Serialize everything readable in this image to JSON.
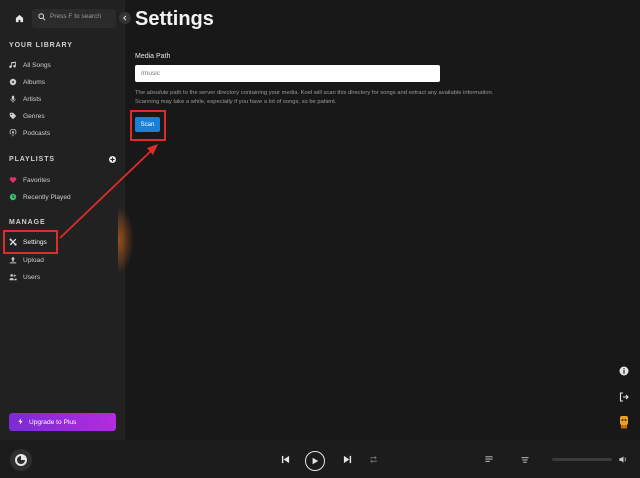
{
  "sidebar": {
    "search": {
      "placeholder": "Press F to search"
    },
    "library": {
      "title": "YOUR LIBRARY",
      "items": [
        {
          "label": "All Songs",
          "icon": "music-note-icon"
        },
        {
          "label": "Albums",
          "icon": "album-icon"
        },
        {
          "label": "Artists",
          "icon": "microphone-icon"
        },
        {
          "label": "Genres",
          "icon": "tag-icon"
        },
        {
          "label": "Podcasts",
          "icon": "podcast-icon"
        }
      ]
    },
    "playlists": {
      "title": "PLAYLISTS",
      "items": [
        {
          "label": "Favorites",
          "icon": "heart-icon",
          "color": "#e0336b"
        },
        {
          "label": "Recently Played",
          "icon": "recent-icon",
          "color": "#35c46b"
        }
      ]
    },
    "manage": {
      "title": "MANAGE",
      "items": [
        {
          "label": "Settings",
          "icon": "tools-icon"
        },
        {
          "label": "Upload",
          "icon": "upload-icon"
        },
        {
          "label": "Users",
          "icon": "users-icon"
        }
      ]
    },
    "upgrade": {
      "label": "Upgrade to Plus",
      "icon": "bolt-icon"
    }
  },
  "main": {
    "title": "Settings",
    "media_path": {
      "label": "Media Path",
      "value": "",
      "placeholder": "/music",
      "help_pre": "The ",
      "help_em": "absolute",
      "help_post": " path to the server directory containing your media. Koel will scan this directory for songs and extract any available information. Scanning may take a while, especially if you have a lot of songs, so be patient."
    },
    "scan_button": {
      "label": "Scan"
    }
  },
  "colors": {
    "accent": "#1a7fd6",
    "highlight": "#e02b2b",
    "upgrade_gradient": [
      "#7a2bd6",
      "#b32be0"
    ]
  }
}
